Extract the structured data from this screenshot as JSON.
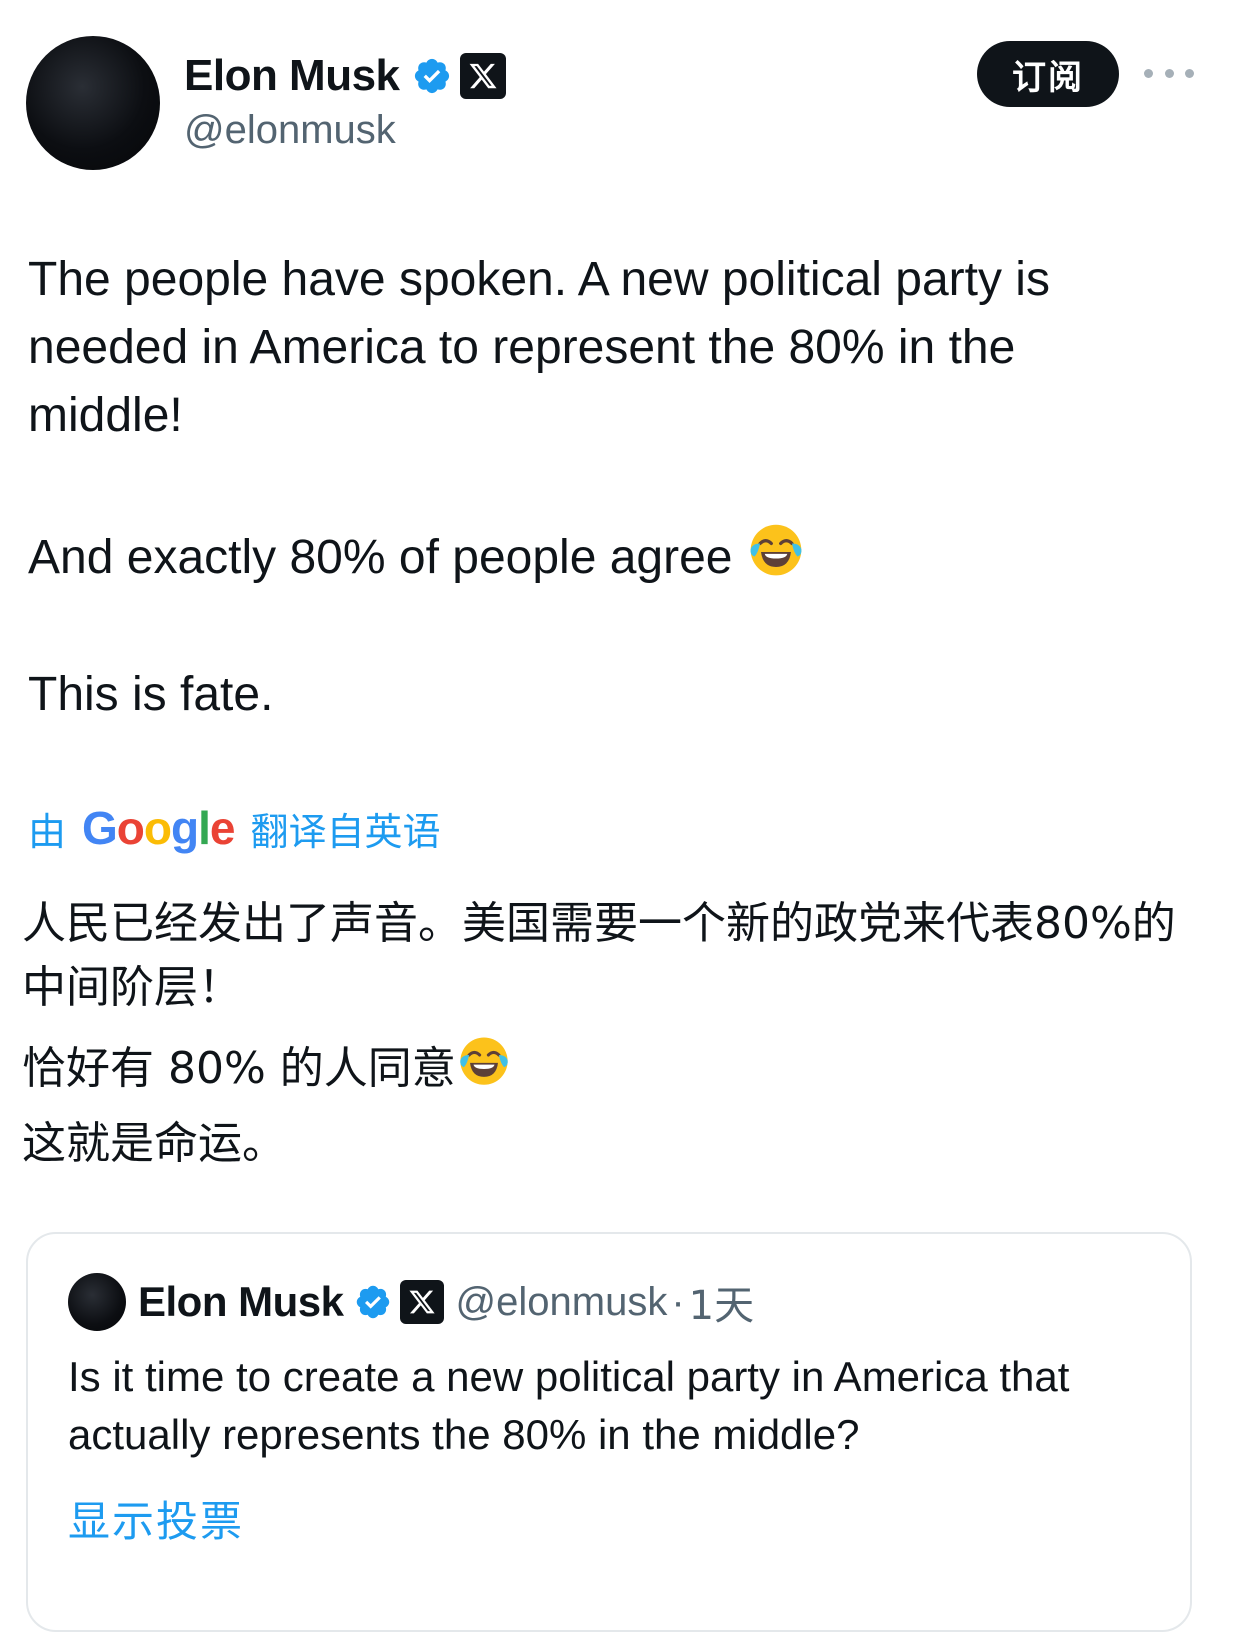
{
  "author": {
    "display_name": "Elon Musk",
    "handle": "@elonmusk",
    "verified_icon": "verified-badge-icon",
    "affiliate_icon": "x-logo-icon"
  },
  "actions": {
    "subscribe_label": "订阅",
    "more_icon": "more-horizontal-icon"
  },
  "tweet": {
    "paragraph_1": "The people have spoken. A new political party is needed in America to represent the 80% in the middle!",
    "paragraph_2": "And exactly 80% of people agree",
    "paragraph_2_emoji": "😂",
    "paragraph_3": "This is fate."
  },
  "translation": {
    "by_label": "由",
    "provider": "Google",
    "from_label": "翻译自英语",
    "line_1": "人民已经发出了声音。美国需要一个新的政党来代表80%的中间阶层！",
    "line_2": "恰好有 80% 的人同意",
    "line_2_emoji": "😂",
    "line_3": "这就是命运。"
  },
  "quoted_tweet": {
    "display_name": "Elon Musk",
    "handle": "@elonmusk",
    "separator": "·",
    "time": "1天",
    "text": "Is it time to create a new political party in America that actually represents the 80% in the middle?",
    "poll_link": "显示投票"
  },
  "colors": {
    "text_primary": "#0f1419",
    "text_secondary": "#536471",
    "accent_blue": "#1d9bf0",
    "google_blue": "#4285f4",
    "google_red": "#ea4335",
    "google_yellow": "#fbbc05",
    "google_green": "#34a853"
  }
}
